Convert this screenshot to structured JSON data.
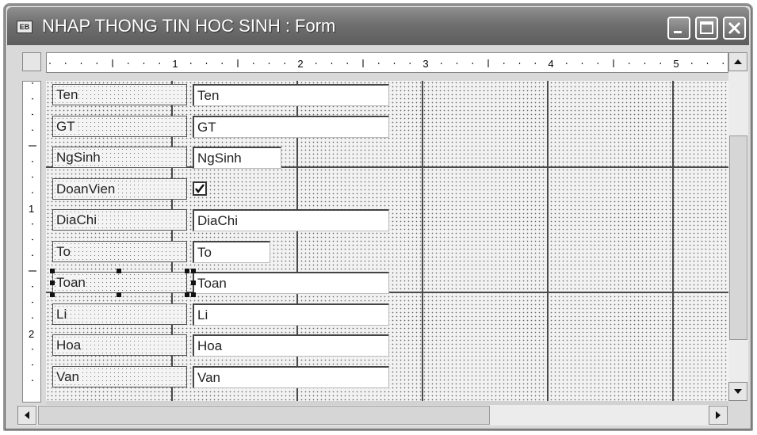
{
  "window": {
    "title": "NHAP THONG TIN HOC SINH : Form",
    "icon": "form-icon"
  },
  "controls": {
    "minimize": "minimize-icon",
    "maximize": "maximize-icon",
    "close": "close-icon"
  },
  "ruler": {
    "horizontal_labels": [
      "1",
      "2",
      "3",
      "4",
      "5"
    ],
    "vertical_labels": [
      "1",
      "2"
    ]
  },
  "fields": [
    {
      "label": "Ten",
      "control": "text",
      "value": "Ten"
    },
    {
      "label": "GT",
      "control": "text",
      "value": "GT"
    },
    {
      "label": "NgSinh",
      "control": "text",
      "value": "NgSinh"
    },
    {
      "label": "DoanVien",
      "control": "checkbox",
      "checked": true
    },
    {
      "label": "DiaChi",
      "control": "text",
      "value": "DiaChi"
    },
    {
      "label": "To",
      "control": "text",
      "value": "To"
    },
    {
      "label": "Toan",
      "control": "text",
      "value": "Toan",
      "selected": true
    },
    {
      "label": "Li",
      "control": "text",
      "value": "Li"
    },
    {
      "label": "Hoa",
      "control": "text",
      "value": "Hoa"
    },
    {
      "label": "Van",
      "control": "text",
      "value": "Van"
    }
  ],
  "scrollbars": {
    "up": "arrow-up-icon",
    "down": "arrow-down-icon",
    "left": "arrow-left-icon",
    "right": "arrow-right-icon"
  }
}
